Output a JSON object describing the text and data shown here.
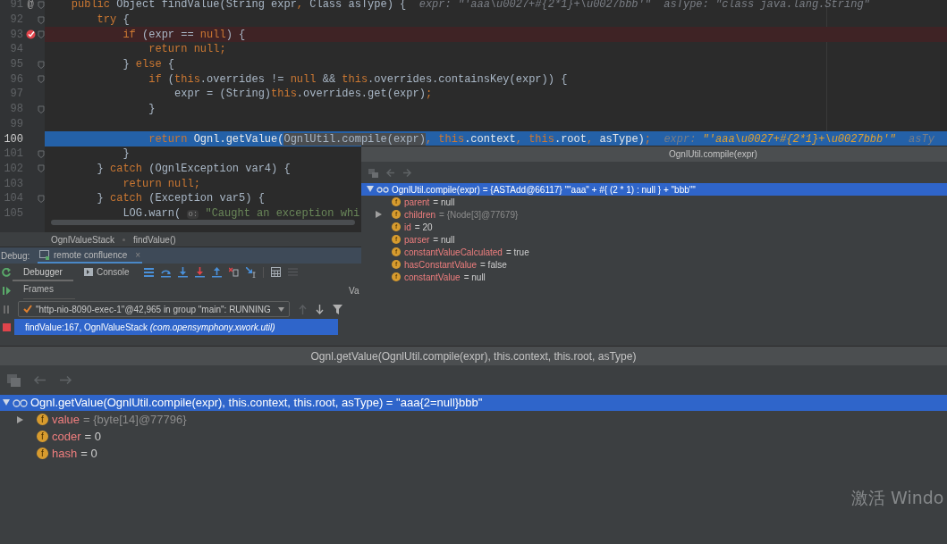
{
  "editor": {
    "lines": [
      {
        "number": "91",
        "gutter_mark": "@",
        "fold": true,
        "tokens": [
          {
            "kind": "kw",
            "text": "    public "
          },
          {
            "kind": "text",
            "text": "Object findValue(String expr"
          },
          {
            "kind": "kw",
            "text": ", "
          },
          {
            "kind": "text",
            "text": "Class asType) {"
          },
          {
            "kind": "hint",
            "text": "  expr: \"'aaa\\u0027+#{2*1}+\\u0027bbb'\"  asType: \"class java.lang.String\""
          }
        ]
      },
      {
        "number": "92",
        "fold": true,
        "tokens": [
          {
            "kind": "kw",
            "text": "        try"
          },
          {
            "kind": "text",
            "text": " {"
          }
        ]
      },
      {
        "number": "93",
        "breakpoint": true,
        "fold": true,
        "tokens": [
          {
            "kind": "kw",
            "text": "            if"
          },
          {
            "kind": "text",
            "text": " (expr == "
          },
          {
            "kind": "kw",
            "text": "null"
          },
          {
            "kind": "text",
            "text": ") {"
          }
        ]
      },
      {
        "number": "94",
        "fold": false,
        "tokens": [
          {
            "kind": "kw",
            "text": "                return null;"
          }
        ]
      },
      {
        "number": "95",
        "fold": true,
        "tokens": [
          {
            "kind": "text",
            "text": "            } "
          },
          {
            "kind": "kw",
            "text": "else"
          },
          {
            "kind": "text",
            "text": " {"
          }
        ]
      },
      {
        "number": "96",
        "fold": true,
        "tokens": [
          {
            "kind": "kw",
            "text": "                if"
          },
          {
            "kind": "text",
            "text": " ("
          },
          {
            "kind": "kw",
            "text": "this"
          },
          {
            "kind": "text",
            "text": ".overrides != "
          },
          {
            "kind": "kw",
            "text": "null"
          },
          {
            "kind": "text",
            "text": " && "
          },
          {
            "kind": "kw",
            "text": "this"
          },
          {
            "kind": "text",
            "text": ".overrides.containsKey(expr)) {"
          }
        ]
      },
      {
        "number": "97",
        "fold": false,
        "tokens": [
          {
            "kind": "text",
            "text": "                    expr = (String)"
          },
          {
            "kind": "kw",
            "text": "this"
          },
          {
            "kind": "text",
            "text": ".overrides.get(expr)"
          },
          {
            "kind": "kw",
            "text": ";"
          }
        ]
      },
      {
        "number": "98",
        "fold": true,
        "tokens": [
          {
            "kind": "text",
            "text": "                }"
          }
        ]
      },
      {
        "number": "99",
        "fold": false
      },
      {
        "number": "100",
        "fold": false,
        "execution_point": true,
        "tokens": [
          {
            "kind": "kw",
            "text": "                return "
          },
          {
            "kind": "text",
            "text": "Ognl.getValue("
          },
          {
            "kind": "sel",
            "text": "OgnlUtil.compile(expr)"
          },
          {
            "kind": "kw",
            "text": ", this"
          },
          {
            "kind": "text",
            "text": ".context"
          },
          {
            "kind": "kw",
            "text": ", this"
          },
          {
            "kind": "text",
            "text": ".root"
          },
          {
            "kind": "kw",
            "text": ", "
          },
          {
            "kind": "text",
            "text": "asType)"
          },
          {
            "kind": "kw",
            "text": ";"
          },
          {
            "kind": "hint",
            "text": "  expr: "
          },
          {
            "kind": "hintval",
            "text": "\"'aaa\\u0027+#{2*1}+\\u0027bbb'\""
          },
          {
            "kind": "hint",
            "text": "  asTy"
          }
        ]
      },
      {
        "number": "101",
        "fold": true,
        "tokens": [
          {
            "kind": "text",
            "text": "            }"
          }
        ]
      },
      {
        "number": "102",
        "fold": true,
        "tokens": [
          {
            "kind": "text",
            "text": "        } "
          },
          {
            "kind": "kw",
            "text": "catch"
          },
          {
            "kind": "text",
            "text": " (OgnlException var4) {"
          }
        ]
      },
      {
        "number": "103",
        "fold": false,
        "tokens": [
          {
            "kind": "kw",
            "text": "            return null;"
          }
        ]
      },
      {
        "number": "104",
        "fold": true,
        "tokens": [
          {
            "kind": "text",
            "text": "        } "
          },
          {
            "kind": "kw",
            "text": "catch"
          },
          {
            "kind": "text",
            "text": " (Exception var5) {"
          }
        ]
      },
      {
        "number": "105",
        "fold": false,
        "tokens": [
          {
            "kind": "text",
            "text": "            LOG.warn( "
          },
          {
            "kind": "param",
            "text": "o:"
          },
          {
            "kind": "str",
            "text": " \"Caught an exception whi"
          }
        ]
      }
    ]
  },
  "breadcrumb": [
    "OgnlValueStack",
    "findValue()"
  ],
  "debug": {
    "label": "Debug:",
    "session_tab": {
      "label": "remote confluence",
      "close": "×"
    },
    "tabs": [
      {
        "label": "Debugger",
        "selected": true
      },
      {
        "label": "Console",
        "selected": false
      }
    ],
    "frames_header": "Frames",
    "variables_header": "Va",
    "thread": "\"http-nio-8090-exec-1\"@42,965 in group \"main\": RUNNING",
    "frames": [
      {
        "text": "findValue:167, OgnlValueStack *(com.opensymphony.xwork.util)*",
        "selected": true
      }
    ]
  },
  "popups": [
    {
      "title": "OgnlUtil.compile(expr)",
      "root": {
        "text": "OgnlUtil.compile(expr) = {ASTAdd@66117} \"\"aaa\" + #{ (2 * 1) : null } + \"bbb\"\"",
        "selected": true,
        "expanded": true
      },
      "fields": [
        {
          "badge": "f",
          "name": "parent",
          "value": "= null",
          "is_reference": false,
          "expandable": false
        },
        {
          "badge": "f",
          "name": "children",
          "value": "= {Node[3]@77679}",
          "is_reference": true,
          "expandable": true
        },
        {
          "badge": "f",
          "name": "id",
          "value": "= 20",
          "is_reference": false,
          "expandable": false
        },
        {
          "badge": "f",
          "name": "parser",
          "value": "= null",
          "is_reference": false,
          "expandable": false
        },
        {
          "badge": "f",
          "name": "constantValueCalculated",
          "value": "= true",
          "is_reference": false,
          "expandable": false
        },
        {
          "badge": "f",
          "name": "hasConstantValue",
          "value": "= false",
          "is_reference": false,
          "expandable": false
        },
        {
          "badge": "f",
          "name": "constantValue",
          "value": "= null",
          "is_reference": false,
          "expandable": false
        }
      ]
    },
    {
      "title": "Ognl.getValue(OgnlUtil.compile(expr), this.context, this.root, asType)",
      "root": {
        "text": "Ognl.getValue(OgnlUtil.compile(expr), this.context, this.root, asType) = \"aaa{2=null}bbb\"",
        "selected": true,
        "expanded": true
      },
      "fields": [
        {
          "badge": "f",
          "name": "value",
          "value": "= {byte[14]@77796}",
          "is_reference": true,
          "expandable": true
        },
        {
          "badge": "f",
          "name": "coder",
          "value": "= 0",
          "is_reference": false,
          "expandable": false
        },
        {
          "badge": "f",
          "name": "hash",
          "value": "= 0",
          "is_reference": false,
          "expandable": false
        }
      ]
    }
  ],
  "os_notice": "激活 Windo"
}
